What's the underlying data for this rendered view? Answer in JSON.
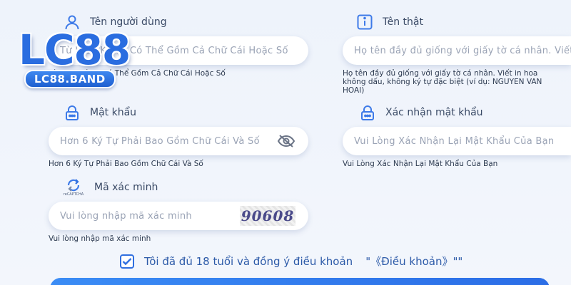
{
  "brand": {
    "logo_text": "LC88",
    "band_text": "LC88.BAND"
  },
  "username": {
    "label": "Tên người dùng",
    "placeholder": "Từ 5-15 Ký Tự Có Thể Gồm Cả Chữ Cái Hoặc Số",
    "hint": "Từ 5-15 Ký Tự Có Thể Gồm Cả Chữ Cái Hoặc Số",
    "icon": "user-icon"
  },
  "realname": {
    "label": "Tên thật",
    "placeholder": "Họ tên đầy đủ giống với giấy tờ cá nhân. Viết in hoa",
    "hint_line1": "Họ tên đầy đủ giống với giấy tờ cá nhân. Viết in hoa",
    "hint_line2": "không dấu, không ký tự đặc biệt (ví dụ: NGUYEN VAN",
    "hint_line3": "HOAI)",
    "icon": "info-icon"
  },
  "password": {
    "label": "Mật khẩu",
    "placeholder": "Hơn 6 Ký Tự Phải Bao Gồm Chữ Cái Và Số",
    "hint": "Hơn 6 Ký Tự Phải Bao Gồm Chữ Cái Và Số",
    "icon": "lock-icon"
  },
  "confirm_password": {
    "label": "Xác nhận mật khẩu",
    "placeholder": "Vui Lòng Xác Nhận Lại Mật Khẩu Của Bạn",
    "hint": "Vui Lòng Xác Nhận Lại Mật Khẩu Của Bạn",
    "icon": "lock-icon"
  },
  "captcha": {
    "label": "Mã xác minh",
    "badge_text": "reCAPTCHA",
    "placeholder": "Vui lòng nhập mã xác minh",
    "hint": "Vui lòng nhập mã xác minh",
    "code": "90608",
    "icon": "recaptcha-icon"
  },
  "agreement": {
    "text": "Tôi đã đủ 18 tuổi và đồng ý điều khoản",
    "link": "\"《Điều khoản》\"\"",
    "checked": true
  },
  "colors": {
    "accent": "#2f6fe0",
    "logo": "#2a6de0",
    "placeholder": "#9aa3b5"
  }
}
